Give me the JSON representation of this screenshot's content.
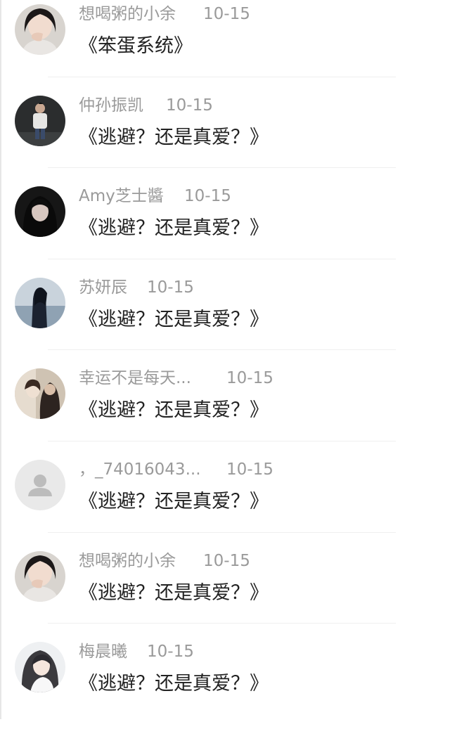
{
  "comments": [
    {
      "name": "想喝粥的小余",
      "time": "10-15",
      "text": "《笨蛋系统》",
      "avatar": "girl-selfie-avatar"
    },
    {
      "name": "仲孙振凯",
      "time": "10-15",
      "text": "《逃避？还是真爱？》",
      "avatar": "man-standing-avatar"
    },
    {
      "name": "Amy芝士醬",
      "time": "10-15",
      "text": "《逃避？还是真爱？》",
      "avatar": "dark-girl-avatar"
    },
    {
      "name": "苏妍辰",
      "time": "10-15",
      "text": "《逃避？还是真爱？》",
      "avatar": "silhouette-sea-avatar"
    },
    {
      "name": "幸运不是每天...",
      "time": "10-15",
      "text": "《逃避？还是真爱？》",
      "avatar": "couple-avatar"
    },
    {
      "name": "，_74016043...",
      "time": "10-15",
      "text": "《逃避？还是真爱？》",
      "avatar": "default-user-avatar"
    },
    {
      "name": "想喝粥的小余",
      "time": "10-15",
      "text": "《逃避？还是真爱？》",
      "avatar": "girl-selfie-avatar"
    },
    {
      "name": "梅晨曦",
      "time": "10-15",
      "text": "《逃避？还是真爱？》",
      "avatar": "anime-girl-avatar"
    }
  ],
  "colors": {
    "name_gray": "#9a9a9a",
    "text_dark": "#222222",
    "divider": "#efefef"
  }
}
